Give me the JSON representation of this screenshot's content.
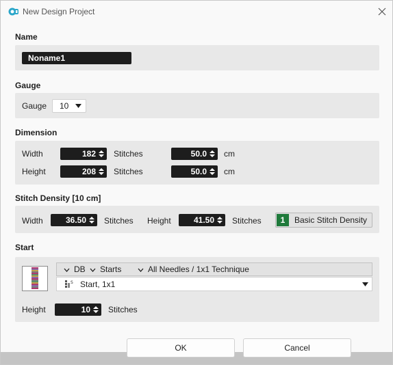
{
  "window": {
    "title": "New Design Project",
    "app_icon": "app-logo-icon",
    "close_icon": "close-icon"
  },
  "name": {
    "label": "Name",
    "value": "Noname1"
  },
  "gauge": {
    "label": "Gauge",
    "field_label": "Gauge",
    "value": "10"
  },
  "dimension": {
    "label": "Dimension",
    "rows": [
      {
        "label": "Width",
        "stitches": "182",
        "stitches_unit": "Stitches",
        "size": "50.0",
        "size_unit": "cm"
      },
      {
        "label": "Height",
        "stitches": "208",
        "stitches_unit": "Stitches",
        "size": "50.0",
        "size_unit": "cm"
      }
    ]
  },
  "density": {
    "label": "Stitch Density [10 cm]",
    "width_label": "Width",
    "width_value": "36.50",
    "width_unit": "Stitches",
    "height_label": "Height",
    "height_value": "41.50",
    "height_unit": "Stitches",
    "preset_badge": "1",
    "preset_label": "Basic Stitch Density",
    "preset_badge_color": "#1f7a3b"
  },
  "start": {
    "label": "Start",
    "breadcrumb": [
      "DB",
      "Starts",
      "All Needles / 1x1 Technique"
    ],
    "selected": "Start, 1x1",
    "height_label": "Height",
    "height_value": "10",
    "height_unit": "Stitches"
  },
  "buttons": {
    "ok": "OK",
    "cancel": "Cancel"
  }
}
